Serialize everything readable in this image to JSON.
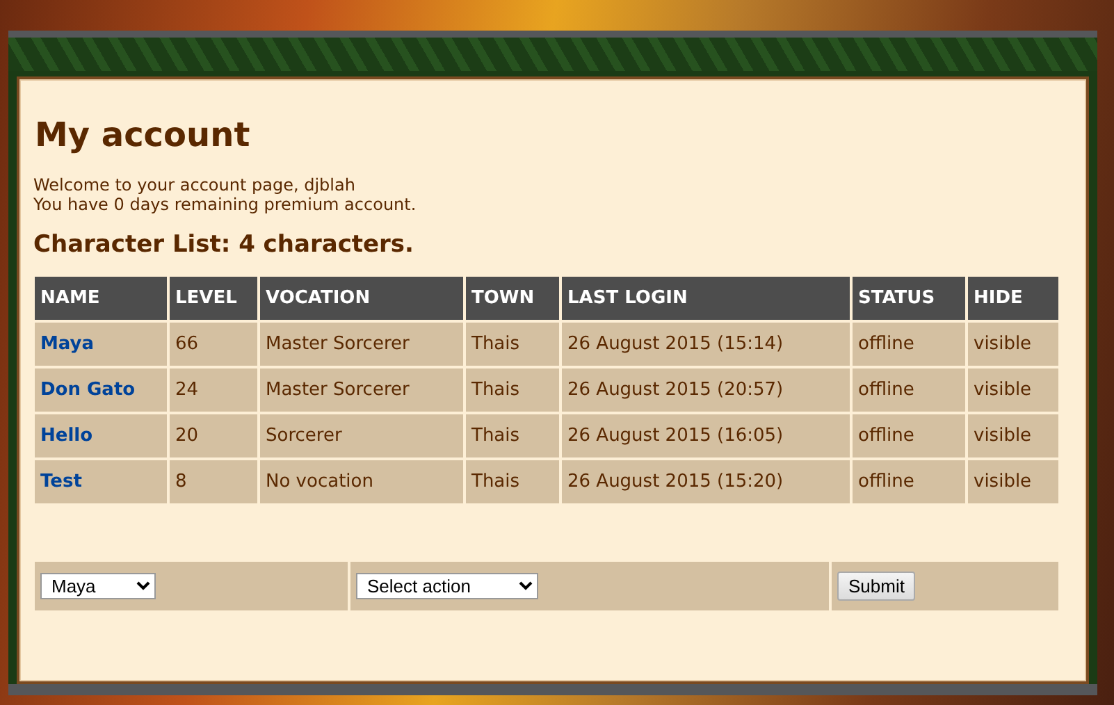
{
  "page": {
    "title": "My account"
  },
  "intro": [
    "Welcome to your account page, djblah",
    "You have 0 days remaining premium account."
  ],
  "character_list": {
    "heading": "Character List: 4 characters.",
    "columns": [
      "NAME",
      "LEVEL",
      "VOCATION",
      "TOWN",
      "LAST LOGIN",
      "STATUS",
      "HIDE"
    ],
    "rows": [
      {
        "name": "Maya",
        "level": "66",
        "vocation": "Master Sorcerer",
        "town": "Thais",
        "last_login": "26 August 2015 (15:14)",
        "status": "offline",
        "hide": "visible"
      },
      {
        "name": "Don Gato",
        "level": "24",
        "vocation": "Master Sorcerer",
        "town": "Thais",
        "last_login": "26 August 2015 (20:57)",
        "status": "offline",
        "hide": "visible"
      },
      {
        "name": "Hello",
        "level": "20",
        "vocation": "Sorcerer",
        "town": "Thais",
        "last_login": "26 August 2015 (16:05)",
        "status": "offline",
        "hide": "visible"
      },
      {
        "name": "Test",
        "level": "8",
        "vocation": "No vocation",
        "town": "Thais",
        "last_login": "26 August 2015 (15:20)",
        "status": "offline",
        "hide": "visible"
      }
    ]
  },
  "action_form": {
    "character": "Maya",
    "action": "Select action",
    "submit": "Submit"
  }
}
